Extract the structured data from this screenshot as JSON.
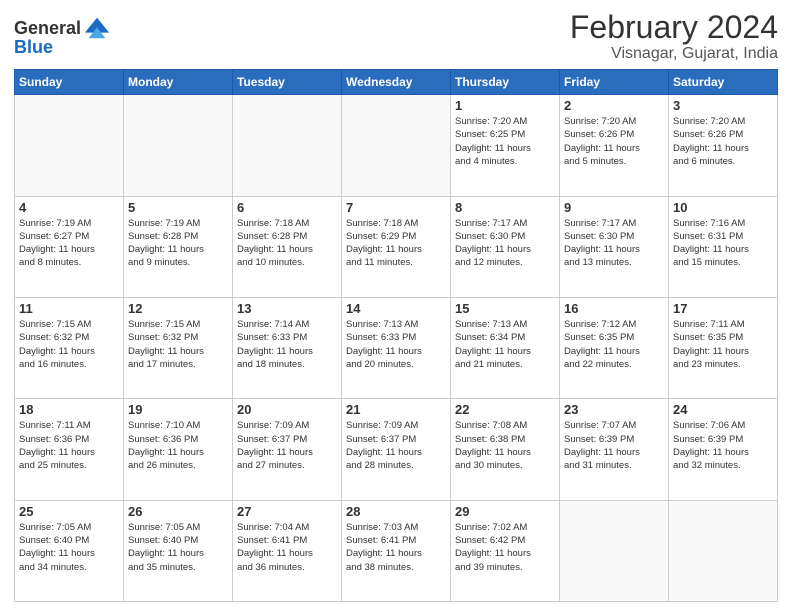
{
  "header": {
    "logo_general": "General",
    "logo_blue": "Blue",
    "main_title": "February 2024",
    "sub_title": "Visnagar, Gujarat, India"
  },
  "weekdays": [
    "Sunday",
    "Monday",
    "Tuesday",
    "Wednesday",
    "Thursday",
    "Friday",
    "Saturday"
  ],
  "weeks": [
    [
      {
        "day": "",
        "info": ""
      },
      {
        "day": "",
        "info": ""
      },
      {
        "day": "",
        "info": ""
      },
      {
        "day": "",
        "info": ""
      },
      {
        "day": "1",
        "info": "Sunrise: 7:20 AM\nSunset: 6:25 PM\nDaylight: 11 hours\nand 4 minutes."
      },
      {
        "day": "2",
        "info": "Sunrise: 7:20 AM\nSunset: 6:26 PM\nDaylight: 11 hours\nand 5 minutes."
      },
      {
        "day": "3",
        "info": "Sunrise: 7:20 AM\nSunset: 6:26 PM\nDaylight: 11 hours\nand 6 minutes."
      }
    ],
    [
      {
        "day": "4",
        "info": "Sunrise: 7:19 AM\nSunset: 6:27 PM\nDaylight: 11 hours\nand 8 minutes."
      },
      {
        "day": "5",
        "info": "Sunrise: 7:19 AM\nSunset: 6:28 PM\nDaylight: 11 hours\nand 9 minutes."
      },
      {
        "day": "6",
        "info": "Sunrise: 7:18 AM\nSunset: 6:28 PM\nDaylight: 11 hours\nand 10 minutes."
      },
      {
        "day": "7",
        "info": "Sunrise: 7:18 AM\nSunset: 6:29 PM\nDaylight: 11 hours\nand 11 minutes."
      },
      {
        "day": "8",
        "info": "Sunrise: 7:17 AM\nSunset: 6:30 PM\nDaylight: 11 hours\nand 12 minutes."
      },
      {
        "day": "9",
        "info": "Sunrise: 7:17 AM\nSunset: 6:30 PM\nDaylight: 11 hours\nand 13 minutes."
      },
      {
        "day": "10",
        "info": "Sunrise: 7:16 AM\nSunset: 6:31 PM\nDaylight: 11 hours\nand 15 minutes."
      }
    ],
    [
      {
        "day": "11",
        "info": "Sunrise: 7:15 AM\nSunset: 6:32 PM\nDaylight: 11 hours\nand 16 minutes."
      },
      {
        "day": "12",
        "info": "Sunrise: 7:15 AM\nSunset: 6:32 PM\nDaylight: 11 hours\nand 17 minutes."
      },
      {
        "day": "13",
        "info": "Sunrise: 7:14 AM\nSunset: 6:33 PM\nDaylight: 11 hours\nand 18 minutes."
      },
      {
        "day": "14",
        "info": "Sunrise: 7:13 AM\nSunset: 6:33 PM\nDaylight: 11 hours\nand 20 minutes."
      },
      {
        "day": "15",
        "info": "Sunrise: 7:13 AM\nSunset: 6:34 PM\nDaylight: 11 hours\nand 21 minutes."
      },
      {
        "day": "16",
        "info": "Sunrise: 7:12 AM\nSunset: 6:35 PM\nDaylight: 11 hours\nand 22 minutes."
      },
      {
        "day": "17",
        "info": "Sunrise: 7:11 AM\nSunset: 6:35 PM\nDaylight: 11 hours\nand 23 minutes."
      }
    ],
    [
      {
        "day": "18",
        "info": "Sunrise: 7:11 AM\nSunset: 6:36 PM\nDaylight: 11 hours\nand 25 minutes."
      },
      {
        "day": "19",
        "info": "Sunrise: 7:10 AM\nSunset: 6:36 PM\nDaylight: 11 hours\nand 26 minutes."
      },
      {
        "day": "20",
        "info": "Sunrise: 7:09 AM\nSunset: 6:37 PM\nDaylight: 11 hours\nand 27 minutes."
      },
      {
        "day": "21",
        "info": "Sunrise: 7:09 AM\nSunset: 6:37 PM\nDaylight: 11 hours\nand 28 minutes."
      },
      {
        "day": "22",
        "info": "Sunrise: 7:08 AM\nSunset: 6:38 PM\nDaylight: 11 hours\nand 30 minutes."
      },
      {
        "day": "23",
        "info": "Sunrise: 7:07 AM\nSunset: 6:39 PM\nDaylight: 11 hours\nand 31 minutes."
      },
      {
        "day": "24",
        "info": "Sunrise: 7:06 AM\nSunset: 6:39 PM\nDaylight: 11 hours\nand 32 minutes."
      }
    ],
    [
      {
        "day": "25",
        "info": "Sunrise: 7:05 AM\nSunset: 6:40 PM\nDaylight: 11 hours\nand 34 minutes."
      },
      {
        "day": "26",
        "info": "Sunrise: 7:05 AM\nSunset: 6:40 PM\nDaylight: 11 hours\nand 35 minutes."
      },
      {
        "day": "27",
        "info": "Sunrise: 7:04 AM\nSunset: 6:41 PM\nDaylight: 11 hours\nand 36 minutes."
      },
      {
        "day": "28",
        "info": "Sunrise: 7:03 AM\nSunset: 6:41 PM\nDaylight: 11 hours\nand 38 minutes."
      },
      {
        "day": "29",
        "info": "Sunrise: 7:02 AM\nSunset: 6:42 PM\nDaylight: 11 hours\nand 39 minutes."
      },
      {
        "day": "",
        "info": ""
      },
      {
        "day": "",
        "info": ""
      }
    ]
  ]
}
